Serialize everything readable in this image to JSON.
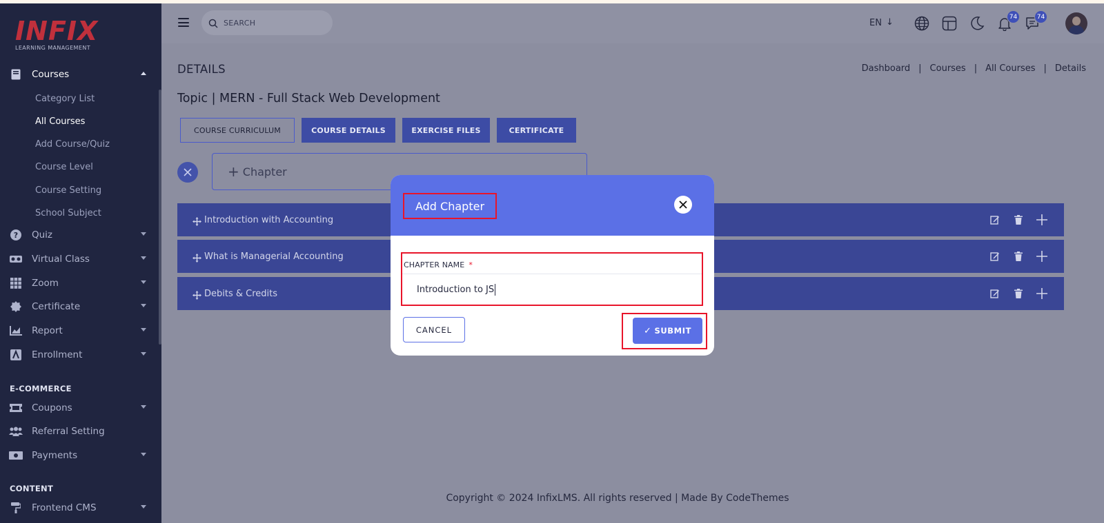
{
  "brand": {
    "logo": "INFIX",
    "tagline": "LEARNING MANAGEMENT"
  },
  "sidebar": {
    "courses": {
      "label": "Courses",
      "icon": "book-icon"
    },
    "course_sub": [
      "Category List",
      "All Courses",
      "Add Course/Quiz",
      "Course Level",
      "Course Setting",
      "School Subject"
    ],
    "items": [
      {
        "label": "Quiz",
        "icon": "question-circle-icon"
      },
      {
        "label": "Virtual Class",
        "icon": "vr-goggles-icon"
      },
      {
        "label": "Zoom",
        "icon": "grid-icon"
      },
      {
        "label": "Certificate",
        "icon": "badge-icon"
      },
      {
        "label": "Report",
        "icon": "chart-icon"
      },
      {
        "label": "Enrollment",
        "icon": "enrollment-icon"
      }
    ],
    "ecommerce_title": "E-COMMERCE",
    "ecommerce": [
      {
        "label": "Coupons",
        "icon": "ticket-icon"
      },
      {
        "label": "Referral Setting",
        "icon": "users-icon"
      },
      {
        "label": "Payments",
        "icon": "money-icon"
      }
    ],
    "content_title": "CONTENT",
    "content": [
      {
        "label": "Frontend CMS",
        "icon": "paint-roller-icon"
      }
    ]
  },
  "topbar": {
    "search_placeholder": "SEARCH",
    "language": "EN",
    "language_arrow": "↓",
    "notification_count": "74",
    "message_count": "74"
  },
  "page": {
    "heading": "DETAILS",
    "breadcrumb": [
      "Dashboard",
      "Courses",
      "All Courses",
      "Details"
    ],
    "breadcrumb_sep": "|",
    "topic": "Topic | MERN - Full Stack Web Development",
    "tabs": [
      "COURSE CURRICULUM",
      "COURSE DETAILS",
      "EXERCISE FILES",
      "CERTIFICATE"
    ],
    "add_chapter_plus": "+",
    "add_chapter_label": "Chapter",
    "chapters": [
      "Introduction with Accounting",
      "What is Managerial Accounting",
      "Debits & Credits"
    ]
  },
  "footer": {
    "text": "Copyright © 2024 InfixLMS. All rights reserved | Made By CodeThemes"
  },
  "modal": {
    "title": "Add Chapter",
    "field_label": "CHAPTER NAME",
    "required_mark": "*",
    "field_value": "Introduction to JS",
    "cancel_label": "CANCEL",
    "submit_check": "✓",
    "submit_label": "SUBMIT"
  },
  "colors": {
    "sidebar_bg": "#202540",
    "overlay_bg": "#8c8ea0",
    "primary": "#5b70e6",
    "chapter_row": "#3a4695",
    "highlight": "#e8142a",
    "logo": "#c0303c"
  }
}
